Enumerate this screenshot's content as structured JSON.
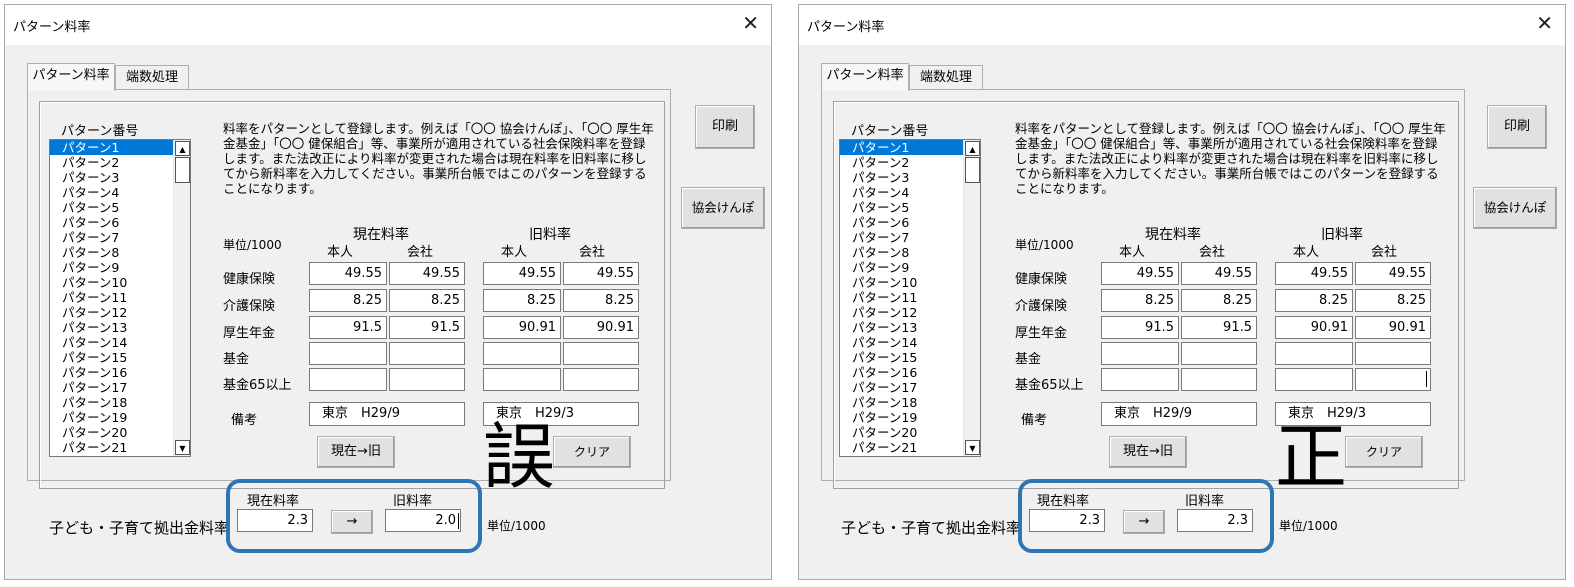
{
  "window_title": "パターン料率",
  "close_glyph": "✕",
  "tabs": [
    "パターン料率",
    "端数処理"
  ],
  "list_label": "パターン番号",
  "pattern_list": [
    "パターン1",
    "パターン2",
    "パターン3",
    "パターン4",
    "パターン5",
    "パターン6",
    "パターン7",
    "パターン8",
    "パターン9",
    "パターン10",
    "パターン11",
    "パターン12",
    "パターン13",
    "パターン14",
    "パターン15",
    "パターン16",
    "パターン17",
    "パターン18",
    "パターン19",
    "パターン20",
    "パターン21"
  ],
  "scroll_up_glyph": "▲",
  "scroll_down_glyph": "▼",
  "description": "料率をパターンとして登録します。例えば「〇〇 協会けんぽ」、「〇〇 厚生年金基金」「〇〇 健保組合」等、事業所が適用されている社会保険料率を登録します。また法改正により料率が変更された場合は現在料率を旧料率に移してから新料率を入力してください。事業所台帳ではこのパターンを登録することになります。",
  "unit_label": "単位/1000",
  "current_rate_label": "現在料率",
  "old_rate_label": "旧料率",
  "person_label": "本人",
  "company_label": "会社",
  "rows": [
    {
      "label": "健康保険",
      "current_person": "49.55",
      "current_company": "49.55",
      "old_person": "49.55",
      "old_company": "49.55"
    },
    {
      "label": "介護保険",
      "current_person": "8.25",
      "current_company": "8.25",
      "old_person": "8.25",
      "old_company": "8.25"
    },
    {
      "label": "厚生年金",
      "current_person": "91.5",
      "current_company": "91.5",
      "old_person": "90.91",
      "old_company": "90.91"
    },
    {
      "label": "基金",
      "current_person": "",
      "current_company": "",
      "old_person": "",
      "old_company": ""
    },
    {
      "label": "基金65以上",
      "current_person": "",
      "current_company": "",
      "old_person": "",
      "old_company": ""
    }
  ],
  "remarks_label": "備考",
  "remarks_current": "東京　H29/9",
  "remarks_old": "東京　H29/3",
  "copy_button": "現在→旧",
  "clear_button": "クリア",
  "print_button": "印刷",
  "kyokai_button": "協会けんぽ",
  "child_label": "子ども・子育て拠出金料率",
  "child_current_label": "現在料率",
  "child_old_label": "旧料率",
  "arrow_button": "→",
  "child_unit": "単位/1000",
  "panels": [
    {
      "child_current": "2.3",
      "child_old": "2.0",
      "annotation": "誤"
    },
    {
      "child_current": "2.3",
      "child_old": "2.3",
      "annotation": "正"
    }
  ],
  "colors": {
    "accent_outline": "#2e75b6",
    "selection": "#0078d7",
    "window_bg": "#f0f0f0"
  }
}
